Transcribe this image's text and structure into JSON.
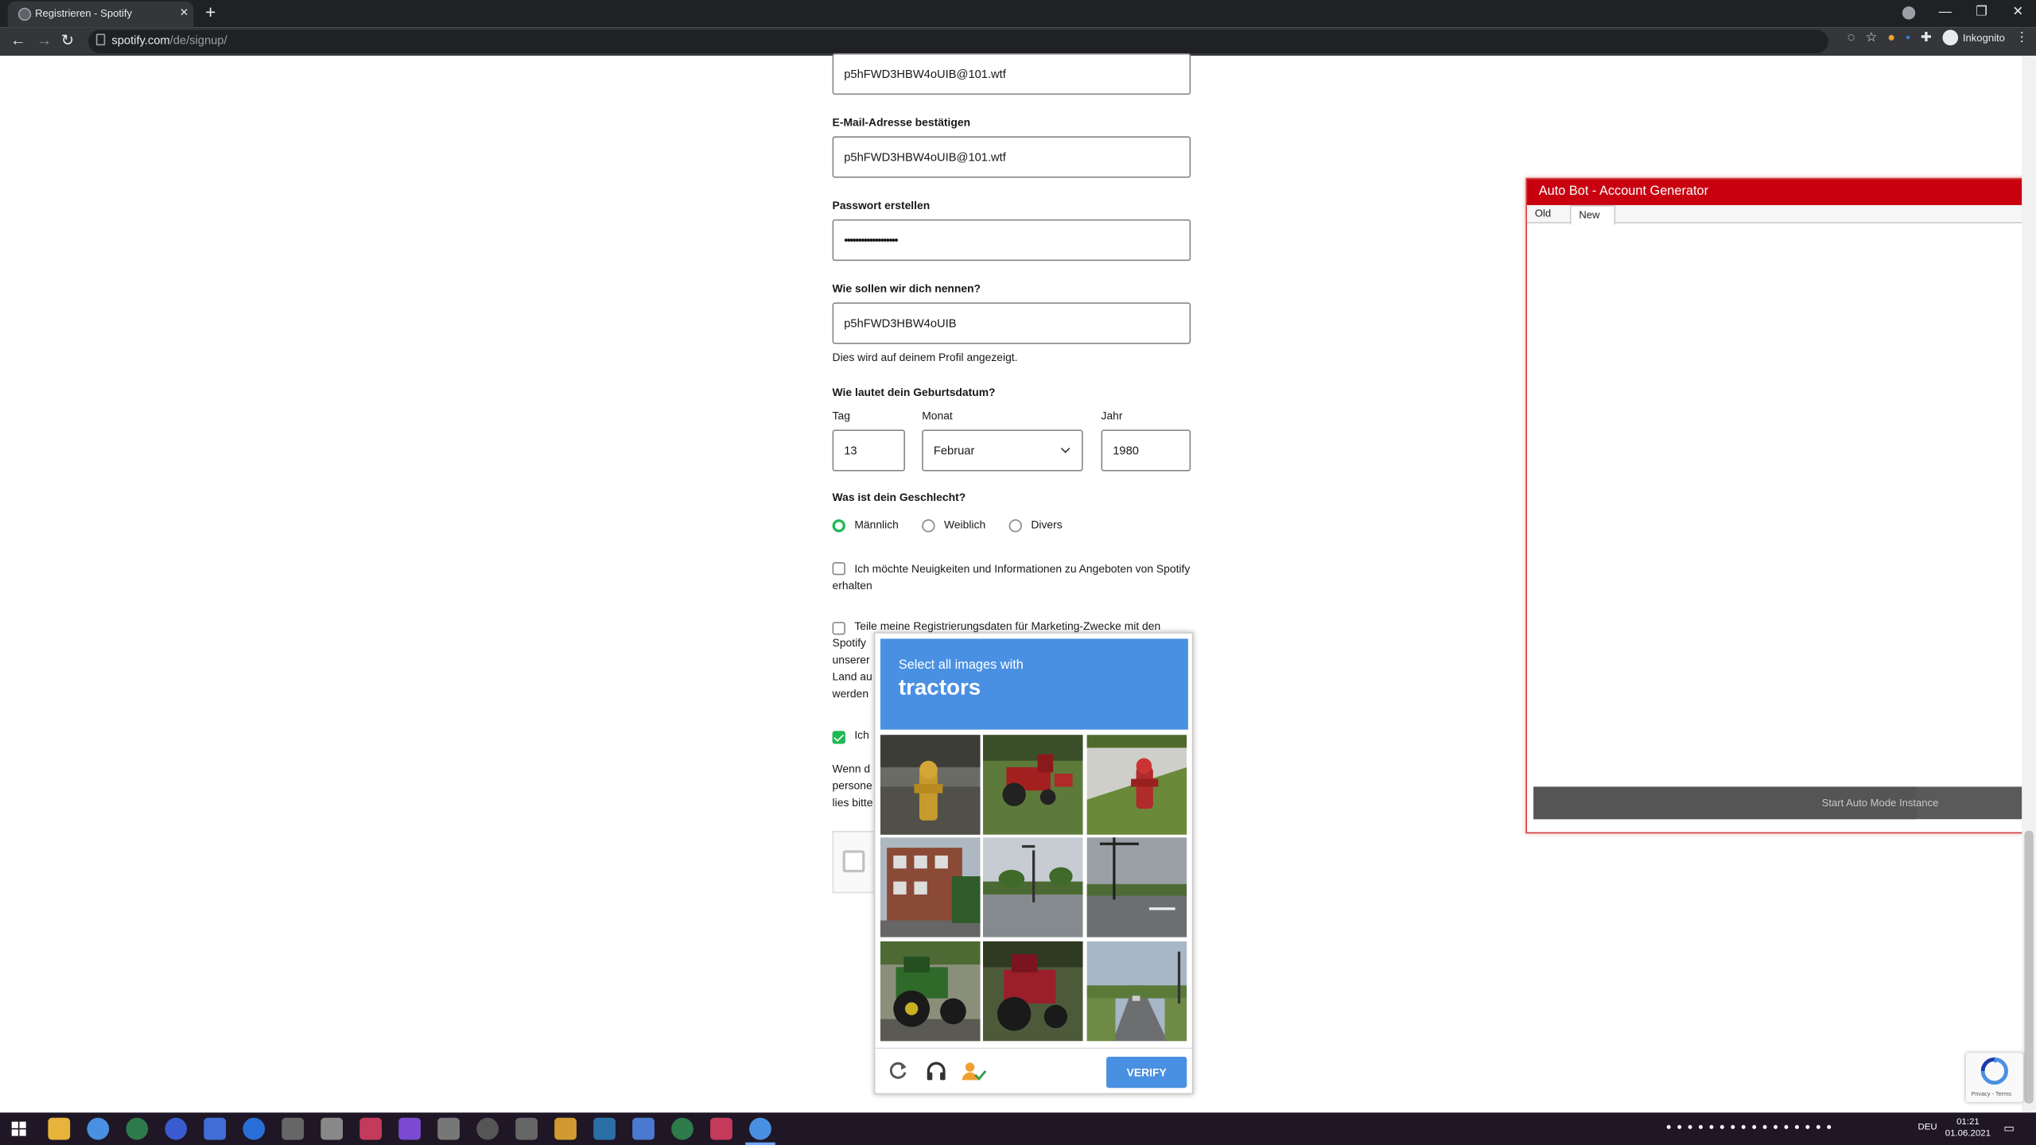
{
  "browser": {
    "tab_title": "Registrieren - Spotify",
    "url_host": "spotify.com",
    "url_path": "/de/signup/",
    "profile_label": "Inkognito"
  },
  "form": {
    "email_value": "p5hFWD3HBW4oUIB@101.wtf",
    "confirm_email_label": "E-Mail-Adresse bestätigen",
    "confirm_email_value": "p5hFWD3HBW4oUIB@101.wtf",
    "password_label": "Passwort erstellen",
    "password_value": "•••••••••••••••••••",
    "name_label": "Wie sollen wir dich nennen?",
    "name_value": "p5hFWD3HBW4oUIB",
    "name_hint": "Dies wird auf deinem Profil angezeigt.",
    "birthdate_label": "Wie lautet dein Geburtsdatum?",
    "day_label": "Tag",
    "day_value": "13",
    "month_label": "Monat",
    "month_value": "Februar",
    "year_label": "Jahr",
    "year_value": "1980",
    "gender_label": "Was ist dein Geschlecht?",
    "gender_options": [
      "Männlich",
      "Weiblich",
      "Divers"
    ],
    "news_checkbox_text": "Ich möchte Neuigkeiten und Informationen zu Angeboten von Spotify erhalten",
    "marketing_line1": "Teile meine Registrierungsdaten für Marketing-Zwecke mit den",
    "marketing_line2": "Spotify",
    "marketing_line3": "unserer",
    "marketing_line4": "Land au",
    "marketing_line5": "werden",
    "terms_checkbox_text": "Ich",
    "privacy_line1": "Wenn d",
    "privacy_line2": "persone",
    "privacy_line3": "lies bitte"
  },
  "captcha": {
    "instruction": "Select all images with",
    "target": "tractors",
    "verify_label": "VERIFY",
    "tiles": [
      "fire-hydrant",
      "tractor",
      "fire-hydrant",
      "building",
      "street",
      "intersection",
      "tractor",
      "tractor",
      "road"
    ]
  },
  "bot": {
    "title": "Auto Bot - Account Generator",
    "tab_old": "Old",
    "tab_new": "New",
    "button_label": "Start Auto Mode Instance"
  },
  "recaptcha": {
    "links": "Privacy - Terms"
  },
  "taskbar": {
    "language": "DEU",
    "time": "01:21",
    "date": "01.06.2021"
  },
  "colors": {
    "spotify_green": "#1db954",
    "captcha_blue": "#4a90e2",
    "bot_red": "#c8000f"
  }
}
